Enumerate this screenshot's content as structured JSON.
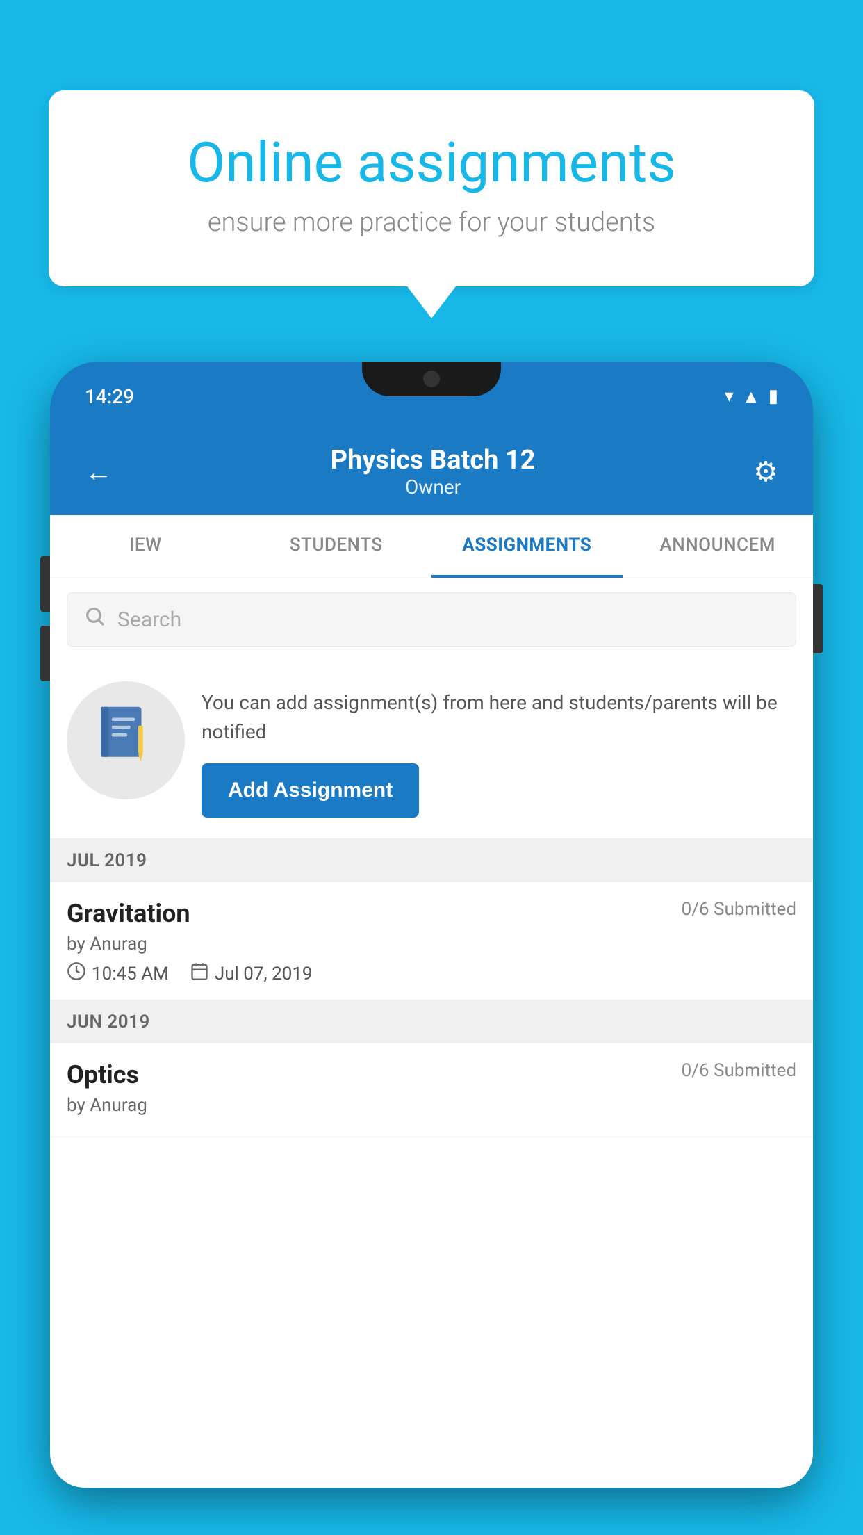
{
  "background_color": "#17b8e8",
  "speech_bubble": {
    "title": "Online assignments",
    "subtitle": "ensure more practice for your students"
  },
  "phone": {
    "status_bar": {
      "time": "14:29",
      "icons": [
        "wifi",
        "signal",
        "battery"
      ]
    },
    "header": {
      "title": "Physics Batch 12",
      "subtitle": "Owner",
      "back_label": "←",
      "settings_label": "⚙"
    },
    "tabs": [
      {
        "label": "IEW",
        "active": false
      },
      {
        "label": "STUDENTS",
        "active": false
      },
      {
        "label": "ASSIGNMENTS",
        "active": true
      },
      {
        "label": "ANNOUNCEM",
        "active": false
      }
    ],
    "search": {
      "placeholder": "Search"
    },
    "promo": {
      "description": "You can add assignment(s) from here and students/parents will be notified",
      "button_label": "Add Assignment"
    },
    "sections": [
      {
        "month": "JUL 2019",
        "assignments": [
          {
            "title": "Gravitation",
            "submitted": "0/6 Submitted",
            "author": "by Anurag",
            "time": "10:45 AM",
            "date": "Jul 07, 2019"
          }
        ]
      },
      {
        "month": "JUN 2019",
        "assignments": [
          {
            "title": "Optics",
            "submitted": "0/6 Submitted",
            "author": "by Anurag",
            "time": "",
            "date": ""
          }
        ]
      }
    ]
  }
}
